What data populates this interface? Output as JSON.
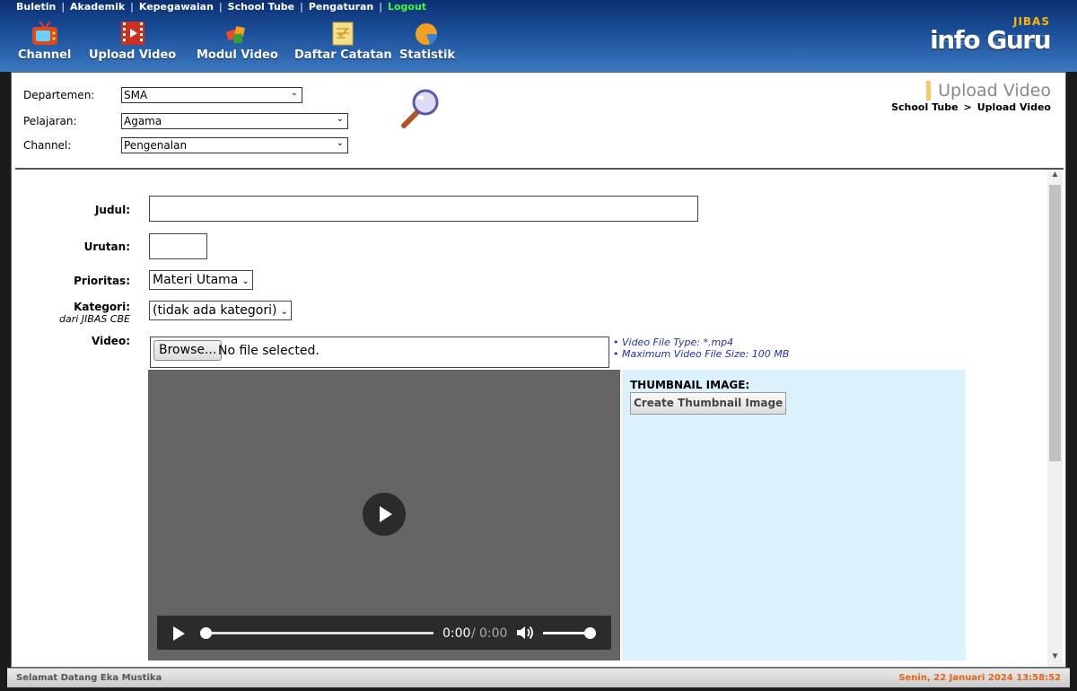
{
  "topnav": {
    "items": [
      "Buletin",
      "Akademik",
      "Kepegawaian",
      "School Tube",
      "Pengaturan"
    ],
    "logout": "Logout"
  },
  "toolbar": {
    "channel": "Channel",
    "upload_video": "Upload Video",
    "modul_video": "Modul Video",
    "daftar_catatan": "Daftar Catatan",
    "statistik": "Statistik"
  },
  "brand": {
    "jibas": "JIBAS",
    "name": "info Guru"
  },
  "filter": {
    "departemen_label": "Departemen:",
    "departemen_value": "SMA",
    "pelajaran_label": "Pelajaran:",
    "pelajaran_value": "Agama",
    "channel_label": "Channel:",
    "channel_value": "Pengenalan"
  },
  "heading": {
    "title": "Upload Video"
  },
  "breadcrumb": {
    "root": "School Tube",
    "sep": ">",
    "current": "Upload Video"
  },
  "form": {
    "judul_label": "Judul:",
    "judul_value": "",
    "urutan_label": "Urutan:",
    "urutan_value": "",
    "prioritas_label": "Prioritas:",
    "prioritas_value": "Materi Utama",
    "kategori_label": "Kategori:",
    "kategori_sublabel": "dari JIBAS CBE",
    "kategori_value": "(tidak ada kategori)",
    "video_label": "Video:",
    "browse_label": "Browse...",
    "file_status": "No file selected.",
    "hint_type": "• Video File Type: *.mp4",
    "hint_size": "• Maximum Video File Size: 100 MB"
  },
  "player": {
    "current_time": "0:00",
    "separator": "/",
    "duration": "0:00",
    "progress": 0,
    "volume": 1.0
  },
  "thumbnail": {
    "title": "THUMBNAIL IMAGE:",
    "button": "Create Thumbnail Image"
  },
  "status": {
    "welcome": "Selamat Datang Eka Mustika",
    "datetime": "Senin, 22 Januari 2024 13:58:52"
  },
  "colors": {
    "header_top": "#0c2f72",
    "header_bottom": "#3b78c0",
    "logout": "#3dfc3d",
    "heading_bar": "#f5c96a",
    "hint_text": "#2230b0",
    "thumb_bg": "#dbf2fc",
    "datetime": "#e0661a"
  }
}
